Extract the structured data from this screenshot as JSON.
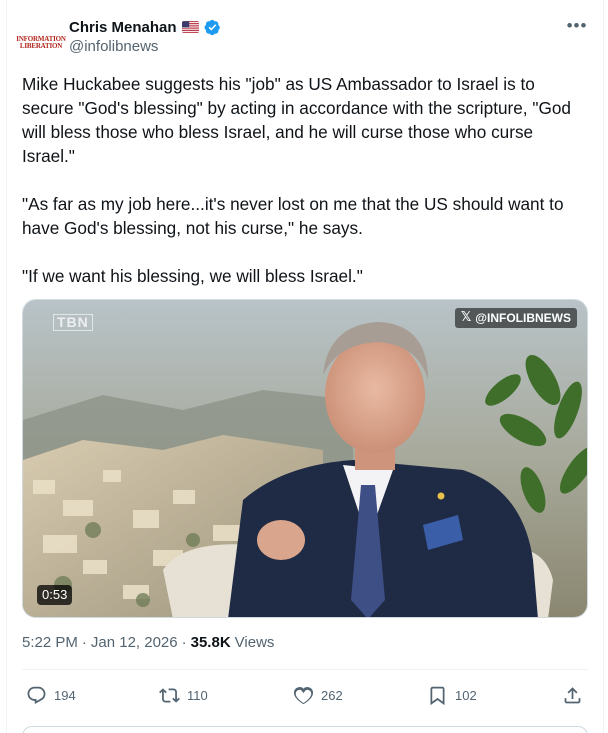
{
  "author": {
    "name": "Chris Menahan",
    "handle": "@infolibnews",
    "avatar_text": [
      "INFORMATION",
      "LIBERATION"
    ],
    "flag_icon": "us-flag-icon",
    "verified_icon": "verified-badge-icon",
    "verified_color": "#1d9bf0"
  },
  "menu_label": "•••",
  "tweet": {
    "paragraphs": [
      "Mike Huckabee suggests his \"job\" as US Ambassador to Israel is to secure \"God's blessing\" by acting in accordance with the scripture, \"God will bless those who bless Israel, and he will curse those who curse Israel.\"",
      "\"As far as my job here...it's never lost on me that the US should want to have God's blessing, not his curse,\" he says.",
      "\"If we want his blessing, we will bless Israel.\""
    ]
  },
  "media": {
    "channel_logo": "TBN",
    "watermark": "@INFOLIBNEWS",
    "watermark_icon": "x-logo-icon",
    "duration": "0:53"
  },
  "meta": {
    "time": "5:22 PM",
    "separator": "·",
    "date": "Jan 12, 2026",
    "views_count": "35.8K",
    "views_label": "Views"
  },
  "actions": {
    "replies": "194",
    "reposts": "110",
    "likes": "262",
    "bookmarks": "102"
  },
  "colors": {
    "text": "#0f1419",
    "secondary": "#536471",
    "border": "#eff3f4"
  }
}
